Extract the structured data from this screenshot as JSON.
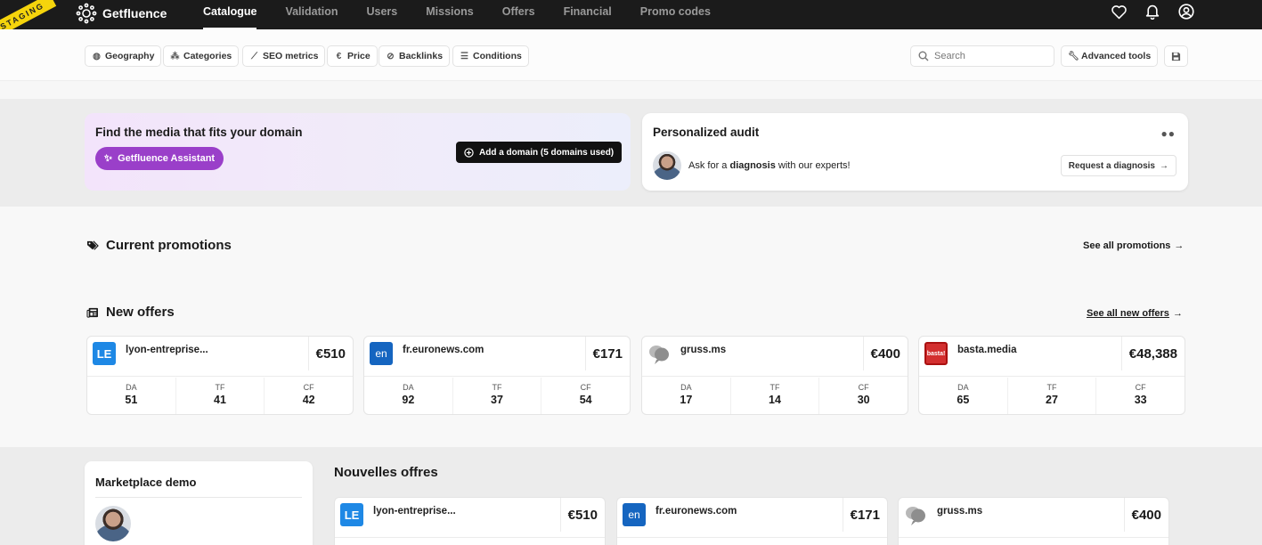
{
  "staging_label": "STAGING",
  "brand": {
    "name": "Getfluence"
  },
  "nav": {
    "items": [
      "Catalogue",
      "Validation",
      "Users",
      "Missions",
      "Offers",
      "Financial",
      "Promo codes"
    ],
    "active": "Catalogue",
    "icons": [
      "heart-icon",
      "bell-icon",
      "user-circle-icon"
    ]
  },
  "filters": {
    "geography": "Geography",
    "categories": "Categories",
    "seo_metrics": "SEO metrics",
    "price": "Price",
    "backlinks": "Backlinks",
    "conditions": "Conditions",
    "search_placeholder": "Search",
    "advanced_tools": "Advanced tools"
  },
  "hero": {
    "find_title": "Find the media that fits your domain",
    "assistant_label": "Getfluence Assistant",
    "add_domain_label": "Add a domain (5 domains used)",
    "audit_title": "Personalized audit",
    "audit_text_prefix": "Ask for a ",
    "audit_text_bold": "diagnosis",
    "audit_text_suffix": " with our experts!",
    "request_label": "Request a diagnosis"
  },
  "promotions": {
    "title": "Current promotions",
    "see_all": "See all promotions"
  },
  "new_offers": {
    "title": "New offers",
    "see_all": "See all new offers",
    "stat_keys": [
      "DA",
      "TF",
      "CF"
    ],
    "cards": [
      {
        "name": "lyon-entreprise...",
        "price": "€510",
        "logo_text": "LE",
        "logo_color": "#1e88e5",
        "da": "51",
        "tf": "41",
        "cf": "42"
      },
      {
        "name": "fr.euronews.com",
        "price": "€171",
        "logo_text": "en",
        "logo_color": "#1565c0",
        "da": "92",
        "tf": "37",
        "cf": "54"
      },
      {
        "name": "gruss.ms",
        "price": "€400",
        "logo_text": "",
        "logo_color": "#9e9e9e",
        "da": "17",
        "tf": "14",
        "cf": "30"
      },
      {
        "name": "basta.media",
        "price": "€48,388",
        "logo_text": "basta!",
        "logo_color": "#d32f2f",
        "da": "65",
        "tf": "27",
        "cf": "33"
      }
    ]
  },
  "lower": {
    "demo_title": "Marketplace demo",
    "nouvelles_title": "Nouvelles offres",
    "cards": [
      {
        "name": "lyon-entreprise...",
        "price": "€510",
        "logo_text": "LE",
        "logo_color": "#1e88e5"
      },
      {
        "name": "fr.euronews.com",
        "price": "€171",
        "logo_text": "en",
        "logo_color": "#1565c0"
      },
      {
        "name": "gruss.ms",
        "price": "€400",
        "logo_text": "",
        "logo_color": "#9e9e9e"
      }
    ]
  }
}
